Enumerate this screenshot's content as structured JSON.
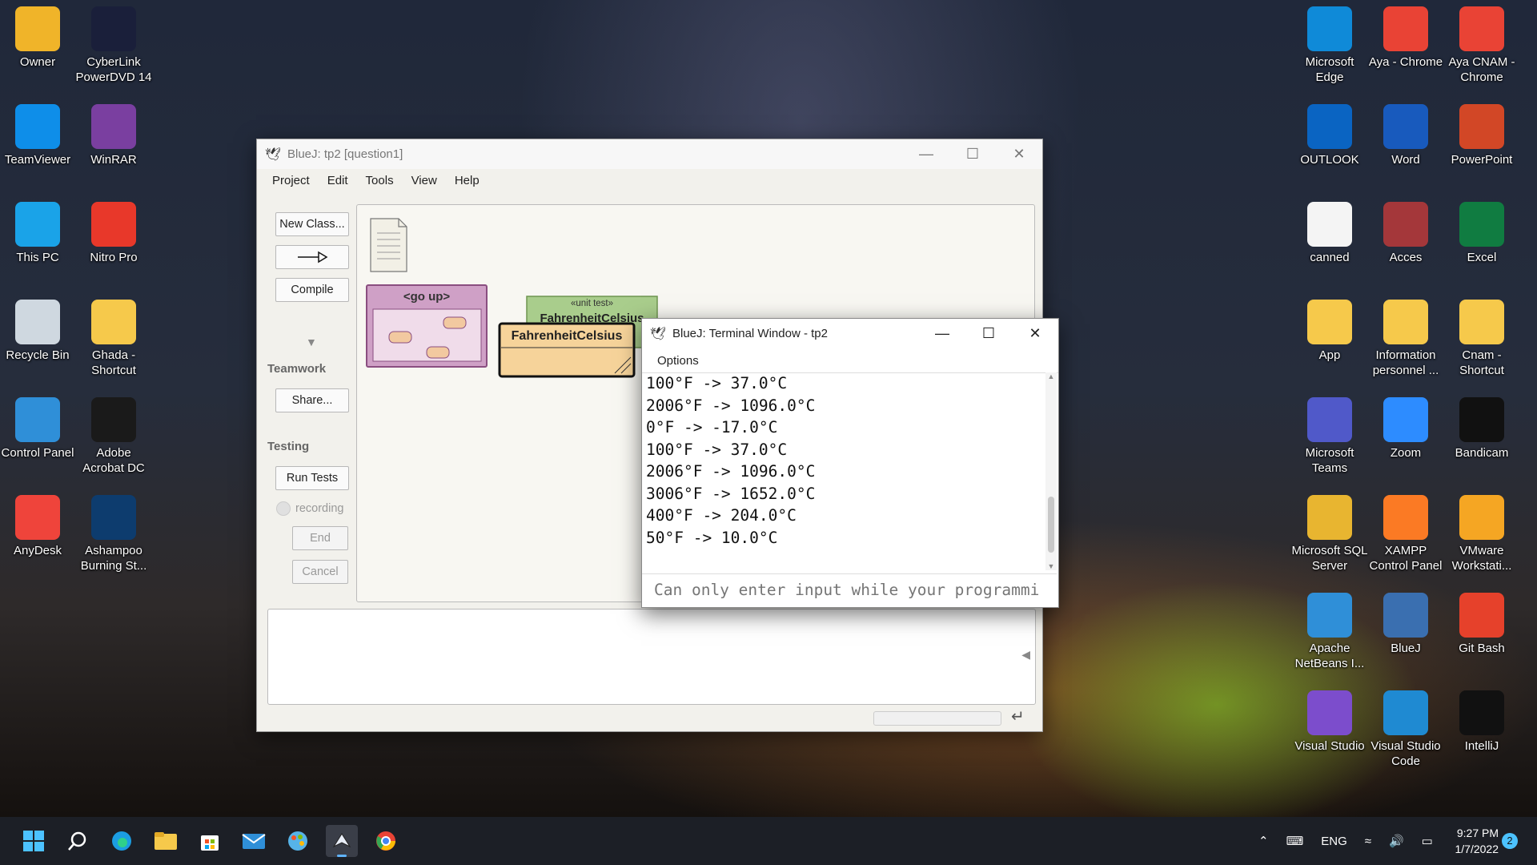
{
  "desktop": {
    "left_icons": [
      {
        "label": "Owner",
        "icon": "user-folder-icon",
        "color": "#f0b429"
      },
      {
        "label": "CyberLink PowerDVD 14",
        "icon": "powerdvd-icon",
        "color": "#1a1f3a"
      },
      {
        "label": "TeamViewer",
        "icon": "teamviewer-icon",
        "color": "#0e8ee9"
      },
      {
        "label": "WinRAR",
        "icon": "winrar-icon",
        "color": "#7a3fa0"
      },
      {
        "label": "This PC",
        "icon": "monitor-icon",
        "color": "#1aa3e8"
      },
      {
        "label": "Nitro Pro",
        "icon": "nitro-icon",
        "color": "#e8382a"
      },
      {
        "label": "Recycle Bin",
        "icon": "recycle-bin-icon",
        "color": "#cfd8e0"
      },
      {
        "label": "Ghada - Shortcut",
        "icon": "folder-icon",
        "color": "#f6c94b"
      },
      {
        "label": "Control Panel",
        "icon": "control-panel-icon",
        "color": "#2f8fd8"
      },
      {
        "label": "Adobe Acrobat DC",
        "icon": "acrobat-icon",
        "color": "#1a1a1a"
      },
      {
        "label": "AnyDesk",
        "icon": "anydesk-icon",
        "color": "#ef443b"
      },
      {
        "label": "Ashampoo Burning St...",
        "icon": "ashampoo-icon",
        "color": "#0d3c6e"
      }
    ],
    "right_icons": [
      {
        "label": "Microsoft Edge",
        "icon": "edge-icon",
        "color": "#0f8ad8"
      },
      {
        "label": "Aya - Chrome",
        "icon": "chrome-icon",
        "color": "#e94335"
      },
      {
        "label": "Aya CNAM - Chrome",
        "icon": "chrome-icon",
        "color": "#e94335"
      },
      {
        "label": "OUTLOOK",
        "icon": "outlook-icon",
        "color": "#0a64c2"
      },
      {
        "label": "Word",
        "icon": "word-icon",
        "color": "#185abd"
      },
      {
        "label": "PowerPoint",
        "icon": "powerpoint-icon",
        "color": "#d24726"
      },
      {
        "label": "canned",
        "icon": "document-icon",
        "color": "#f4f4f4"
      },
      {
        "label": "Acces",
        "icon": "access-icon",
        "color": "#a4373a"
      },
      {
        "label": "Excel",
        "icon": "excel-icon",
        "color": "#107c41"
      },
      {
        "label": "App",
        "icon": "folder-icon",
        "color": "#f6c94b"
      },
      {
        "label": "Information personnel ...",
        "icon": "folder-icon",
        "color": "#f6c94b"
      },
      {
        "label": "Cnam - Shortcut",
        "icon": "folder-icon",
        "color": "#f6c94b"
      },
      {
        "label": "Microsoft Teams",
        "icon": "teams-icon",
        "color": "#5059c9"
      },
      {
        "label": "Zoom",
        "icon": "zoom-icon",
        "color": "#2d8cff"
      },
      {
        "label": "Bandicam",
        "icon": "bandicam-icon",
        "color": "#111111"
      },
      {
        "label": "Microsoft SQL Server",
        "icon": "sql-server-icon",
        "color": "#e8b530"
      },
      {
        "label": "XAMPP Control Panel",
        "icon": "xampp-icon",
        "color": "#fb7a24"
      },
      {
        "label": "VMware Workstati...",
        "icon": "vmware-icon",
        "color": "#f5a623"
      },
      {
        "label": "Apache NetBeans I...",
        "icon": "netbeans-icon",
        "color": "#2f8fd8"
      },
      {
        "label": "BlueJ",
        "icon": "bluej-icon",
        "color": "#3a6fb0"
      },
      {
        "label": "Git Bash",
        "icon": "git-bash-icon",
        "color": "#e6412b"
      },
      {
        "label": "Visual Studio",
        "icon": "visual-studio-icon",
        "color": "#7c4dcc"
      },
      {
        "label": "Visual Studio Code",
        "icon": "vscode-icon",
        "color": "#1f8ad2"
      },
      {
        "label": "IntelliJ",
        "icon": "intellij-icon",
        "color": "#111111"
      }
    ]
  },
  "bluej": {
    "title": "BlueJ:  tp2  [question1]",
    "menu": [
      "Project",
      "Edit",
      "Tools",
      "View",
      "Help"
    ],
    "buttons": {
      "new_class": "New Class...",
      "compile": "Compile",
      "share": "Share...",
      "run_tests": "Run Tests",
      "recording": "recording",
      "end": "End",
      "cancel": "Cancel"
    },
    "headers": {
      "teamwork": "Teamwork",
      "testing": "Testing"
    },
    "diagram": {
      "package": "<go up>",
      "unit_test_stereotype": "«unit test»",
      "unit_test_name": "FahrenheitCelsius",
      "class_name": "FahrenheitCelsius",
      "colors": {
        "package": "#cfa0c6",
        "class": "#f6d39a",
        "test": "#a9cd8c"
      }
    }
  },
  "terminal": {
    "title": "BlueJ: Terminal Window - tp2",
    "menu": [
      "Options"
    ],
    "lines": [
      "100°F -> 37.0°C",
      "2006°F -> 1096.0°C",
      "0°F -> -17.0°C",
      "100°F -> 37.0°C",
      "2006°F -> 1096.0°C",
      "3006°F -> 1652.0°C",
      "400°F -> 204.0°C",
      "50°F -> 10.0°C"
    ],
    "input_placeholder": "Can only enter input while your programmi"
  },
  "taskbar": {
    "apps": [
      "start-icon",
      "search-icon",
      "edge-icon",
      "file-explorer-icon",
      "store-icon",
      "mail-icon",
      "paint-icon",
      "bluej-icon",
      "chrome-icon"
    ],
    "language": "ENG",
    "time": "9:27 PM",
    "date": "1/7/2022",
    "notifications": "2"
  }
}
